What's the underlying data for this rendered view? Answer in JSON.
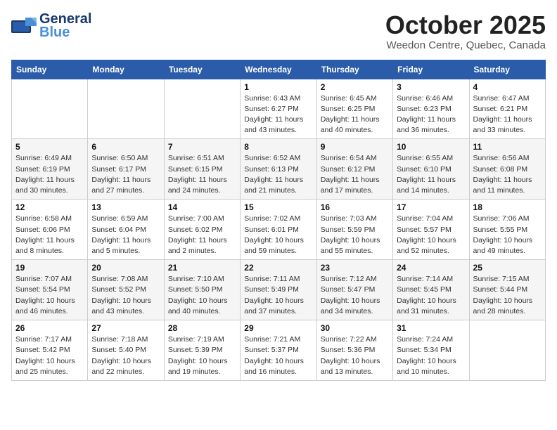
{
  "header": {
    "logo_general": "General",
    "logo_blue": "Blue",
    "month_title": "October 2025",
    "location": "Weedon Centre, Quebec, Canada"
  },
  "days_of_week": [
    "Sunday",
    "Monday",
    "Tuesday",
    "Wednesday",
    "Thursday",
    "Friday",
    "Saturday"
  ],
  "weeks": [
    [
      null,
      null,
      null,
      {
        "day": "1",
        "sunrise": "6:43 AM",
        "sunset": "6:27 PM",
        "daylight": "11 hours and 43 minutes."
      },
      {
        "day": "2",
        "sunrise": "6:45 AM",
        "sunset": "6:25 PM",
        "daylight": "11 hours and 40 minutes."
      },
      {
        "day": "3",
        "sunrise": "6:46 AM",
        "sunset": "6:23 PM",
        "daylight": "11 hours and 36 minutes."
      },
      {
        "day": "4",
        "sunrise": "6:47 AM",
        "sunset": "6:21 PM",
        "daylight": "11 hours and 33 minutes."
      }
    ],
    [
      {
        "day": "5",
        "sunrise": "6:49 AM",
        "sunset": "6:19 PM",
        "daylight": "11 hours and 30 minutes."
      },
      {
        "day": "6",
        "sunrise": "6:50 AM",
        "sunset": "6:17 PM",
        "daylight": "11 hours and 27 minutes."
      },
      {
        "day": "7",
        "sunrise": "6:51 AM",
        "sunset": "6:15 PM",
        "daylight": "11 hours and 24 minutes."
      },
      {
        "day": "8",
        "sunrise": "6:52 AM",
        "sunset": "6:13 PM",
        "daylight": "11 hours and 21 minutes."
      },
      {
        "day": "9",
        "sunrise": "6:54 AM",
        "sunset": "6:12 PM",
        "daylight": "11 hours and 17 minutes."
      },
      {
        "day": "10",
        "sunrise": "6:55 AM",
        "sunset": "6:10 PM",
        "daylight": "11 hours and 14 minutes."
      },
      {
        "day": "11",
        "sunrise": "6:56 AM",
        "sunset": "6:08 PM",
        "daylight": "11 hours and 11 minutes."
      }
    ],
    [
      {
        "day": "12",
        "sunrise": "6:58 AM",
        "sunset": "6:06 PM",
        "daylight": "11 hours and 8 minutes."
      },
      {
        "day": "13",
        "sunrise": "6:59 AM",
        "sunset": "6:04 PM",
        "daylight": "11 hours and 5 minutes."
      },
      {
        "day": "14",
        "sunrise": "7:00 AM",
        "sunset": "6:02 PM",
        "daylight": "11 hours and 2 minutes."
      },
      {
        "day": "15",
        "sunrise": "7:02 AM",
        "sunset": "6:01 PM",
        "daylight": "10 hours and 59 minutes."
      },
      {
        "day": "16",
        "sunrise": "7:03 AM",
        "sunset": "5:59 PM",
        "daylight": "10 hours and 55 minutes."
      },
      {
        "day": "17",
        "sunrise": "7:04 AM",
        "sunset": "5:57 PM",
        "daylight": "10 hours and 52 minutes."
      },
      {
        "day": "18",
        "sunrise": "7:06 AM",
        "sunset": "5:55 PM",
        "daylight": "10 hours and 49 minutes."
      }
    ],
    [
      {
        "day": "19",
        "sunrise": "7:07 AM",
        "sunset": "5:54 PM",
        "daylight": "10 hours and 46 minutes."
      },
      {
        "day": "20",
        "sunrise": "7:08 AM",
        "sunset": "5:52 PM",
        "daylight": "10 hours and 43 minutes."
      },
      {
        "day": "21",
        "sunrise": "7:10 AM",
        "sunset": "5:50 PM",
        "daylight": "10 hours and 40 minutes."
      },
      {
        "day": "22",
        "sunrise": "7:11 AM",
        "sunset": "5:49 PM",
        "daylight": "10 hours and 37 minutes."
      },
      {
        "day": "23",
        "sunrise": "7:12 AM",
        "sunset": "5:47 PM",
        "daylight": "10 hours and 34 minutes."
      },
      {
        "day": "24",
        "sunrise": "7:14 AM",
        "sunset": "5:45 PM",
        "daylight": "10 hours and 31 minutes."
      },
      {
        "day": "25",
        "sunrise": "7:15 AM",
        "sunset": "5:44 PM",
        "daylight": "10 hours and 28 minutes."
      }
    ],
    [
      {
        "day": "26",
        "sunrise": "7:17 AM",
        "sunset": "5:42 PM",
        "daylight": "10 hours and 25 minutes."
      },
      {
        "day": "27",
        "sunrise": "7:18 AM",
        "sunset": "5:40 PM",
        "daylight": "10 hours and 22 minutes."
      },
      {
        "day": "28",
        "sunrise": "7:19 AM",
        "sunset": "5:39 PM",
        "daylight": "10 hours and 19 minutes."
      },
      {
        "day": "29",
        "sunrise": "7:21 AM",
        "sunset": "5:37 PM",
        "daylight": "10 hours and 16 minutes."
      },
      {
        "day": "30",
        "sunrise": "7:22 AM",
        "sunset": "5:36 PM",
        "daylight": "10 hours and 13 minutes."
      },
      {
        "day": "31",
        "sunrise": "7:24 AM",
        "sunset": "5:34 PM",
        "daylight": "10 hours and 10 minutes."
      },
      null
    ]
  ],
  "labels": {
    "sunrise_label": "Sunrise:",
    "sunset_label": "Sunset:",
    "daylight_label": "Daylight:"
  }
}
